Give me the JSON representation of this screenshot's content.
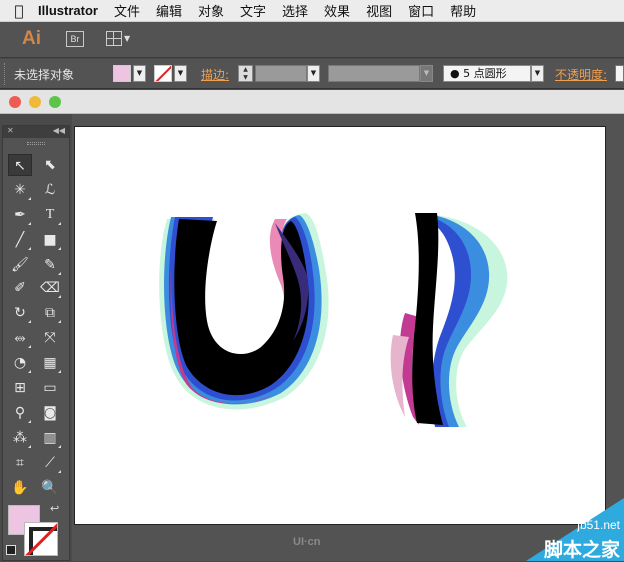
{
  "menubar": {
    "app_name": "Illustrator",
    "items": [
      "文件",
      "编辑",
      "对象",
      "文字",
      "选择",
      "效果",
      "视图",
      "窗口",
      "帮助"
    ]
  },
  "appbar": {
    "logo": "Ai",
    "bridge_label": "Br"
  },
  "control_bar": {
    "selection_status": "未选择对象",
    "stroke_label": "描边:",
    "brush_label": "5 点圆形",
    "opacity_label": "不透明度:"
  },
  "colors": {
    "fill": "#eec4e3",
    "stroke": "none",
    "accent_label": "#f0a050"
  },
  "tools": [
    "selection-tool",
    "direct-selection-tool",
    "magic-wand-tool",
    "lasso-tool",
    "pen-tool",
    "type-tool",
    "line-tool",
    "rectangle-tool",
    "paintbrush-tool",
    "pencil-tool",
    "blob-brush-tool",
    "eraser-tool",
    "rotate-tool",
    "scale-tool",
    "width-tool",
    "free-transform-tool",
    "shape-builder-tool",
    "perspective-grid-tool",
    "mesh-tool",
    "gradient-tool",
    "eyedropper-tool",
    "blend-tool",
    "symbol-sprayer-tool",
    "column-graph-tool",
    "artboard-tool",
    "slice-tool",
    "hand-tool",
    "zoom-tool"
  ],
  "watermark": {
    "ui_cn": "UI·cn",
    "site": "jb51.net",
    "site_name": "脚本之家"
  }
}
